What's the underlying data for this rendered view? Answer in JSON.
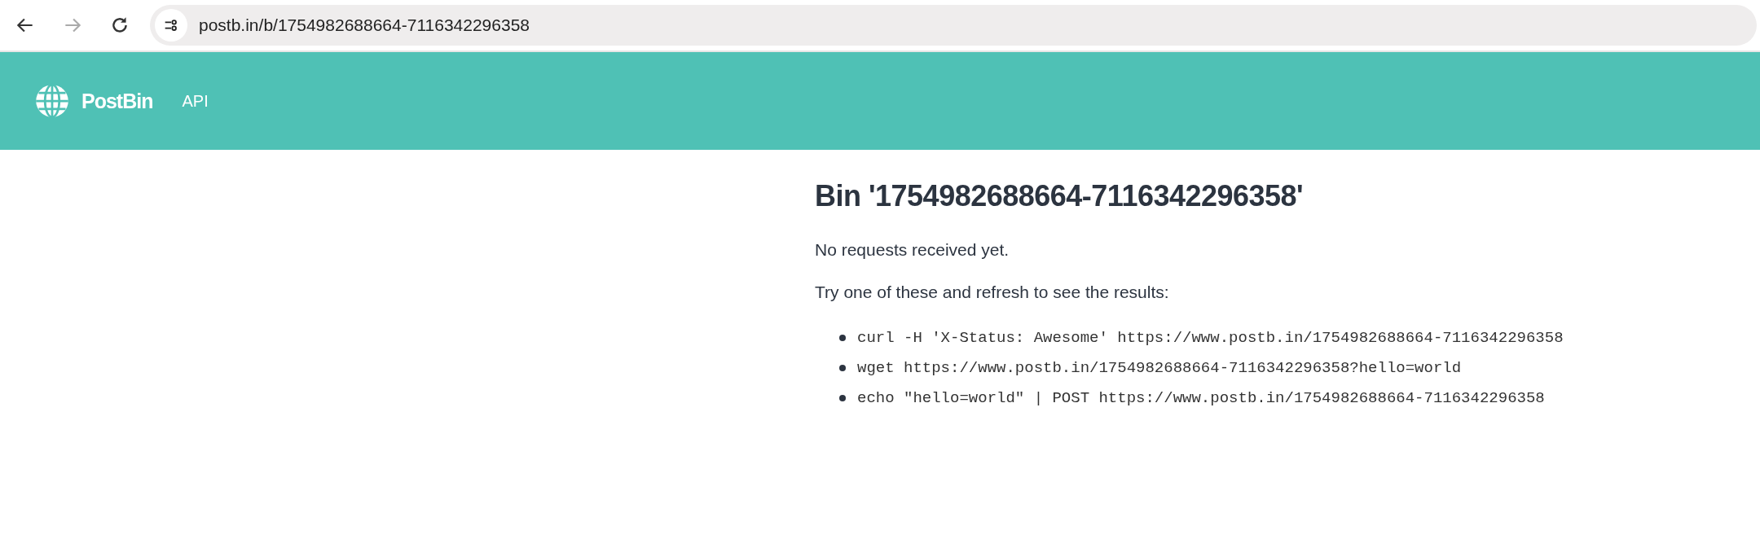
{
  "browser": {
    "url": "postb.in/b/1754982688664-7116342296358",
    "forward_disabled": true
  },
  "navbar": {
    "brand": "PostBin",
    "links": [
      "API"
    ]
  },
  "content": {
    "title": "Bin '1754982688664-7116342296358'",
    "status": "No requests received yet.",
    "instructions": "Try one of these and refresh to see the results:",
    "commands": [
      "curl -H 'X-Status: Awesome' https://www.postb.in/1754982688664-7116342296358",
      "wget https://www.postb.in/1754982688664-7116342296358?hello=world",
      "echo \"hello=world\" | POST https://www.postb.in/1754982688664-7116342296358"
    ]
  }
}
